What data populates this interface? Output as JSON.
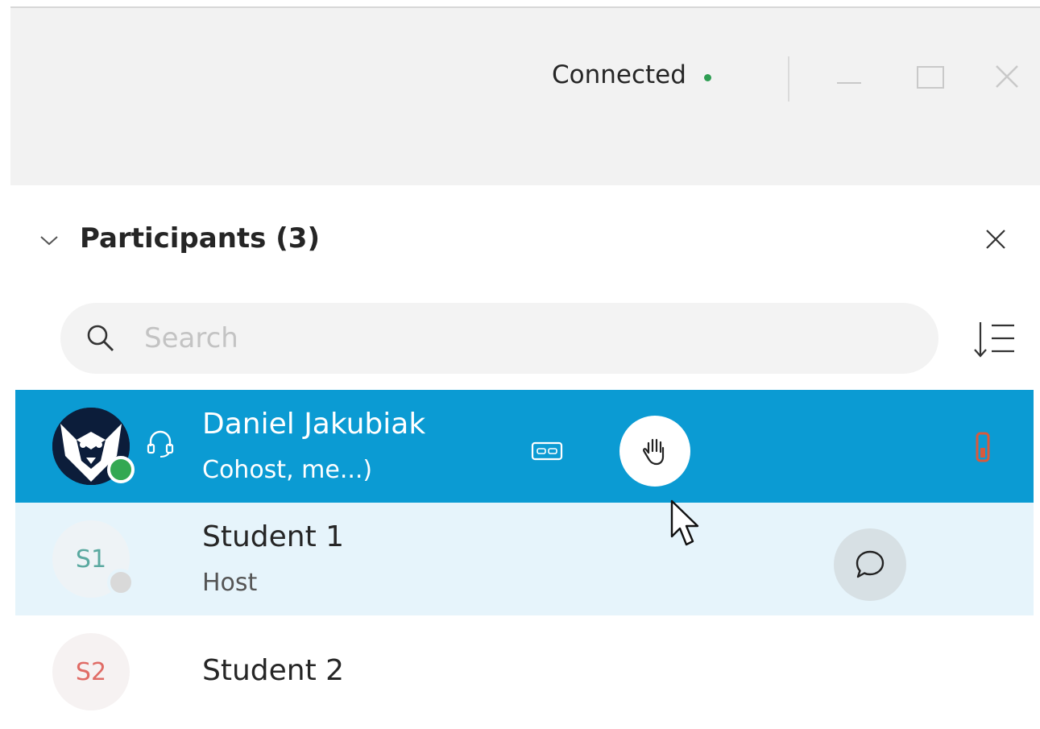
{
  "window": {
    "status_text": "Connected",
    "status_color": "#2f9e53"
  },
  "panel": {
    "title": "Participants (3)",
    "search_placeholder": "Search"
  },
  "participants": [
    {
      "name": "Daniel Jakubiak",
      "role": "Cohost, me...)",
      "presence": "online",
      "avatar": "husky-logo-photo",
      "selected": true
    },
    {
      "name": "Student 1",
      "role": "Host",
      "presence": "idle",
      "initials": "S1"
    },
    {
      "name": "Student 2",
      "role": "",
      "presence": "none",
      "initials": "S2"
    }
  ],
  "icons": {
    "collapse": "chevron-down-icon",
    "close": "close-icon",
    "search": "search-icon",
    "sort": "sort-icon",
    "headset": "headset-icon",
    "captions": "closed-caption-icon",
    "lower_hand": "hand-icon",
    "signal": "signal-icon",
    "chat": "chat-icon"
  },
  "colors": {
    "selected_row": "#0b9bd3",
    "hover_row": "#e6f4fb",
    "s1_initials": "#5aa9a0",
    "s2_initials": "#e06c66"
  }
}
